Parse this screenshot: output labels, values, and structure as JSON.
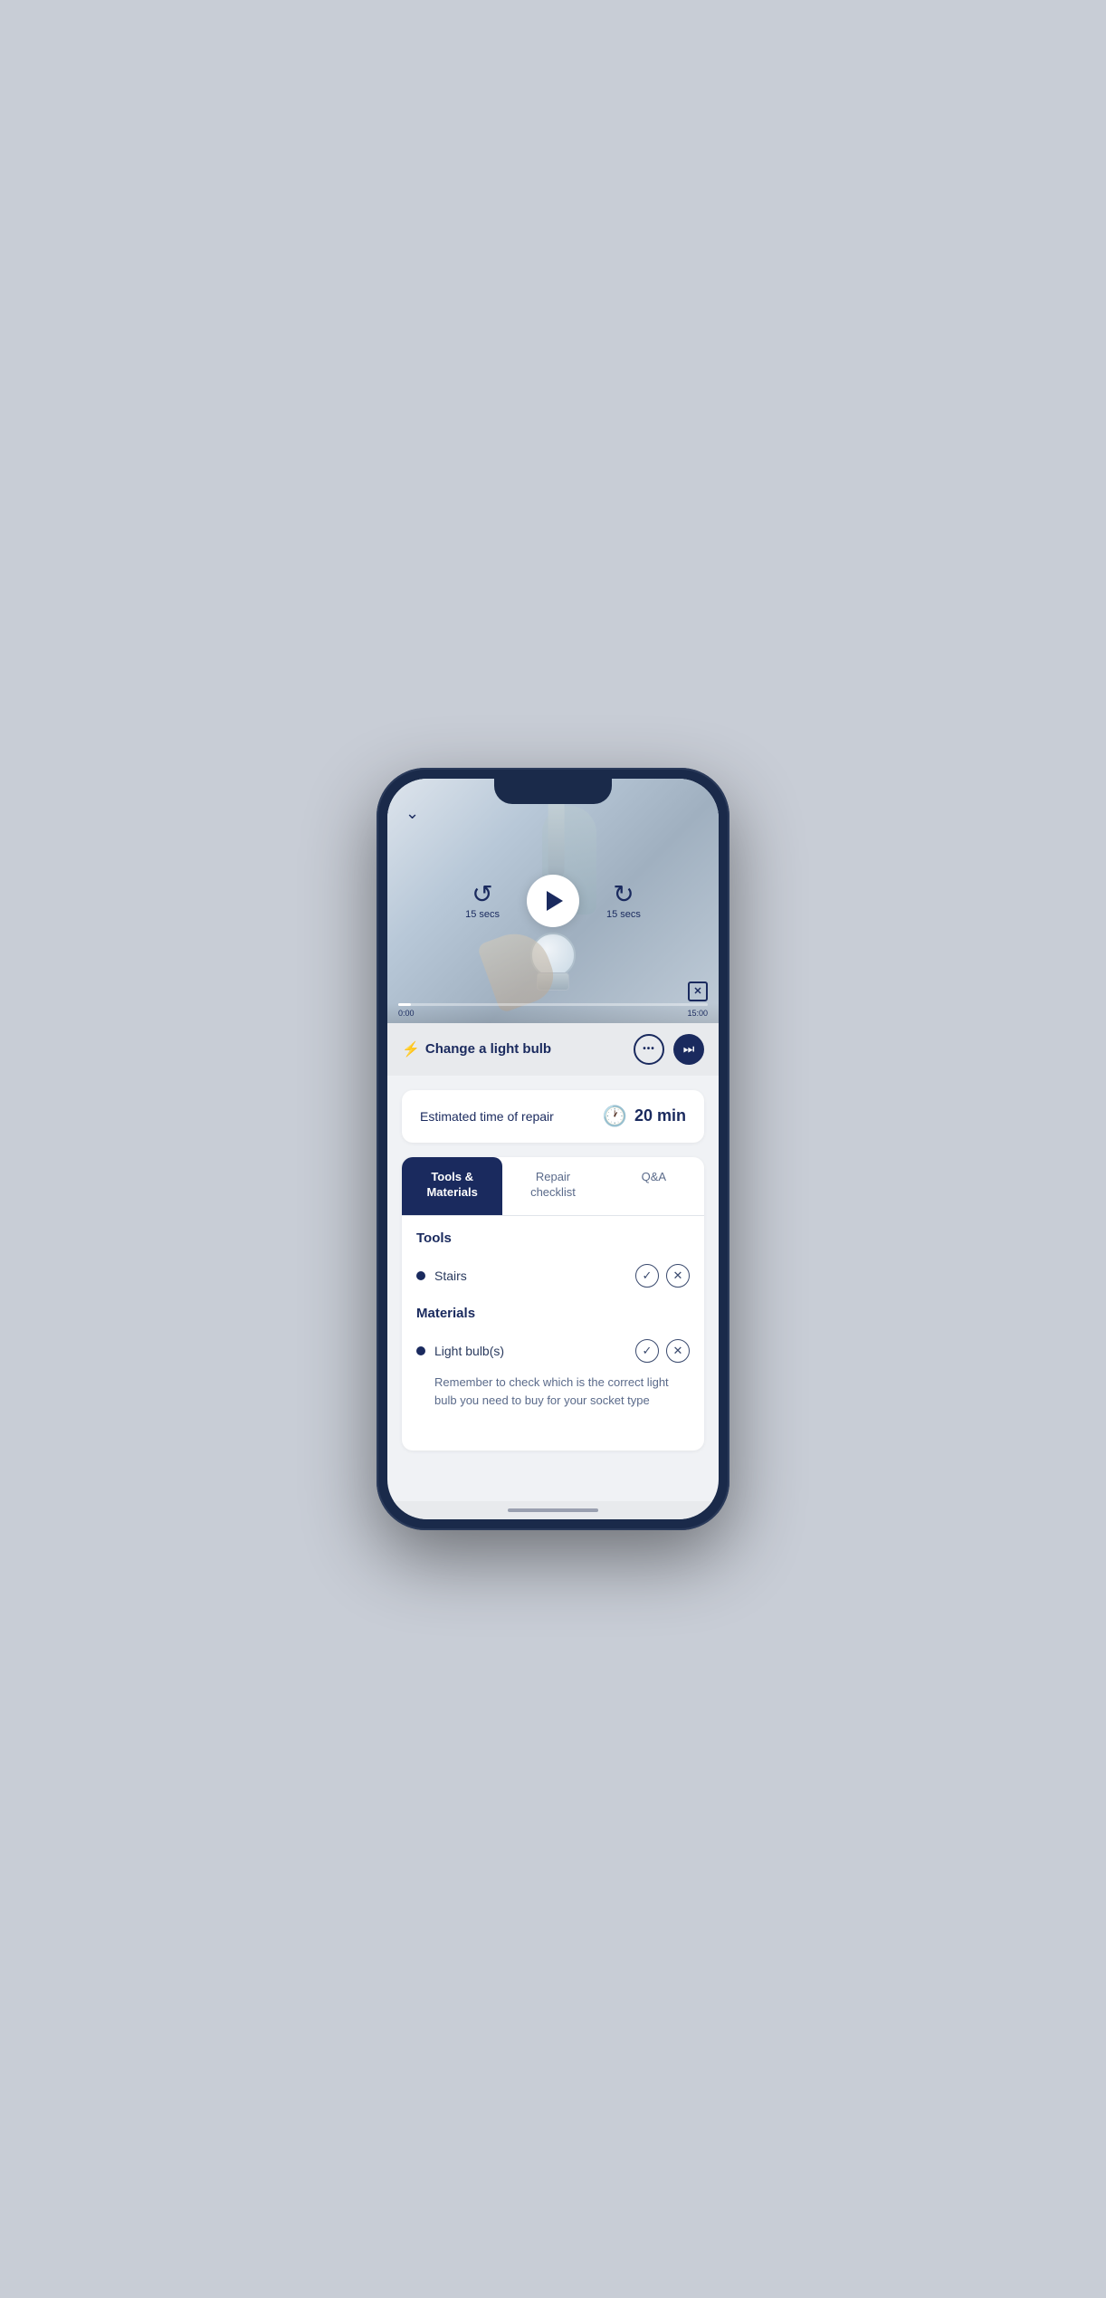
{
  "phone": {
    "chevron": "chevron-down"
  },
  "video": {
    "rewind_label": "15 secs",
    "forward_label": "15 secs",
    "time_start": "0:00",
    "time_end": "15:00",
    "fullscreen_icon": "✕"
  },
  "title_bar": {
    "lightning": "⚡",
    "title": "Change a light bulb",
    "more_icon": "•••",
    "skip_icon": "⏭"
  },
  "estimated_time": {
    "label": "Estimated time of repair",
    "clock": "🕐",
    "value": "20 min"
  },
  "tabs": [
    {
      "id": "tools",
      "label": "Tools &\nMaterials",
      "active": true
    },
    {
      "id": "checklist",
      "label": "Repair\nchecklist",
      "active": false
    },
    {
      "id": "qa",
      "label": "Q&A",
      "active": false
    }
  ],
  "tools_section": {
    "title": "Tools",
    "items": [
      {
        "name": "Stairs"
      }
    ]
  },
  "materials_section": {
    "title": "Materials",
    "items": [
      {
        "name": "Light bulb(s)",
        "note": "Remember to check which is the correct light bulb you need to buy for your socket type"
      }
    ]
  }
}
